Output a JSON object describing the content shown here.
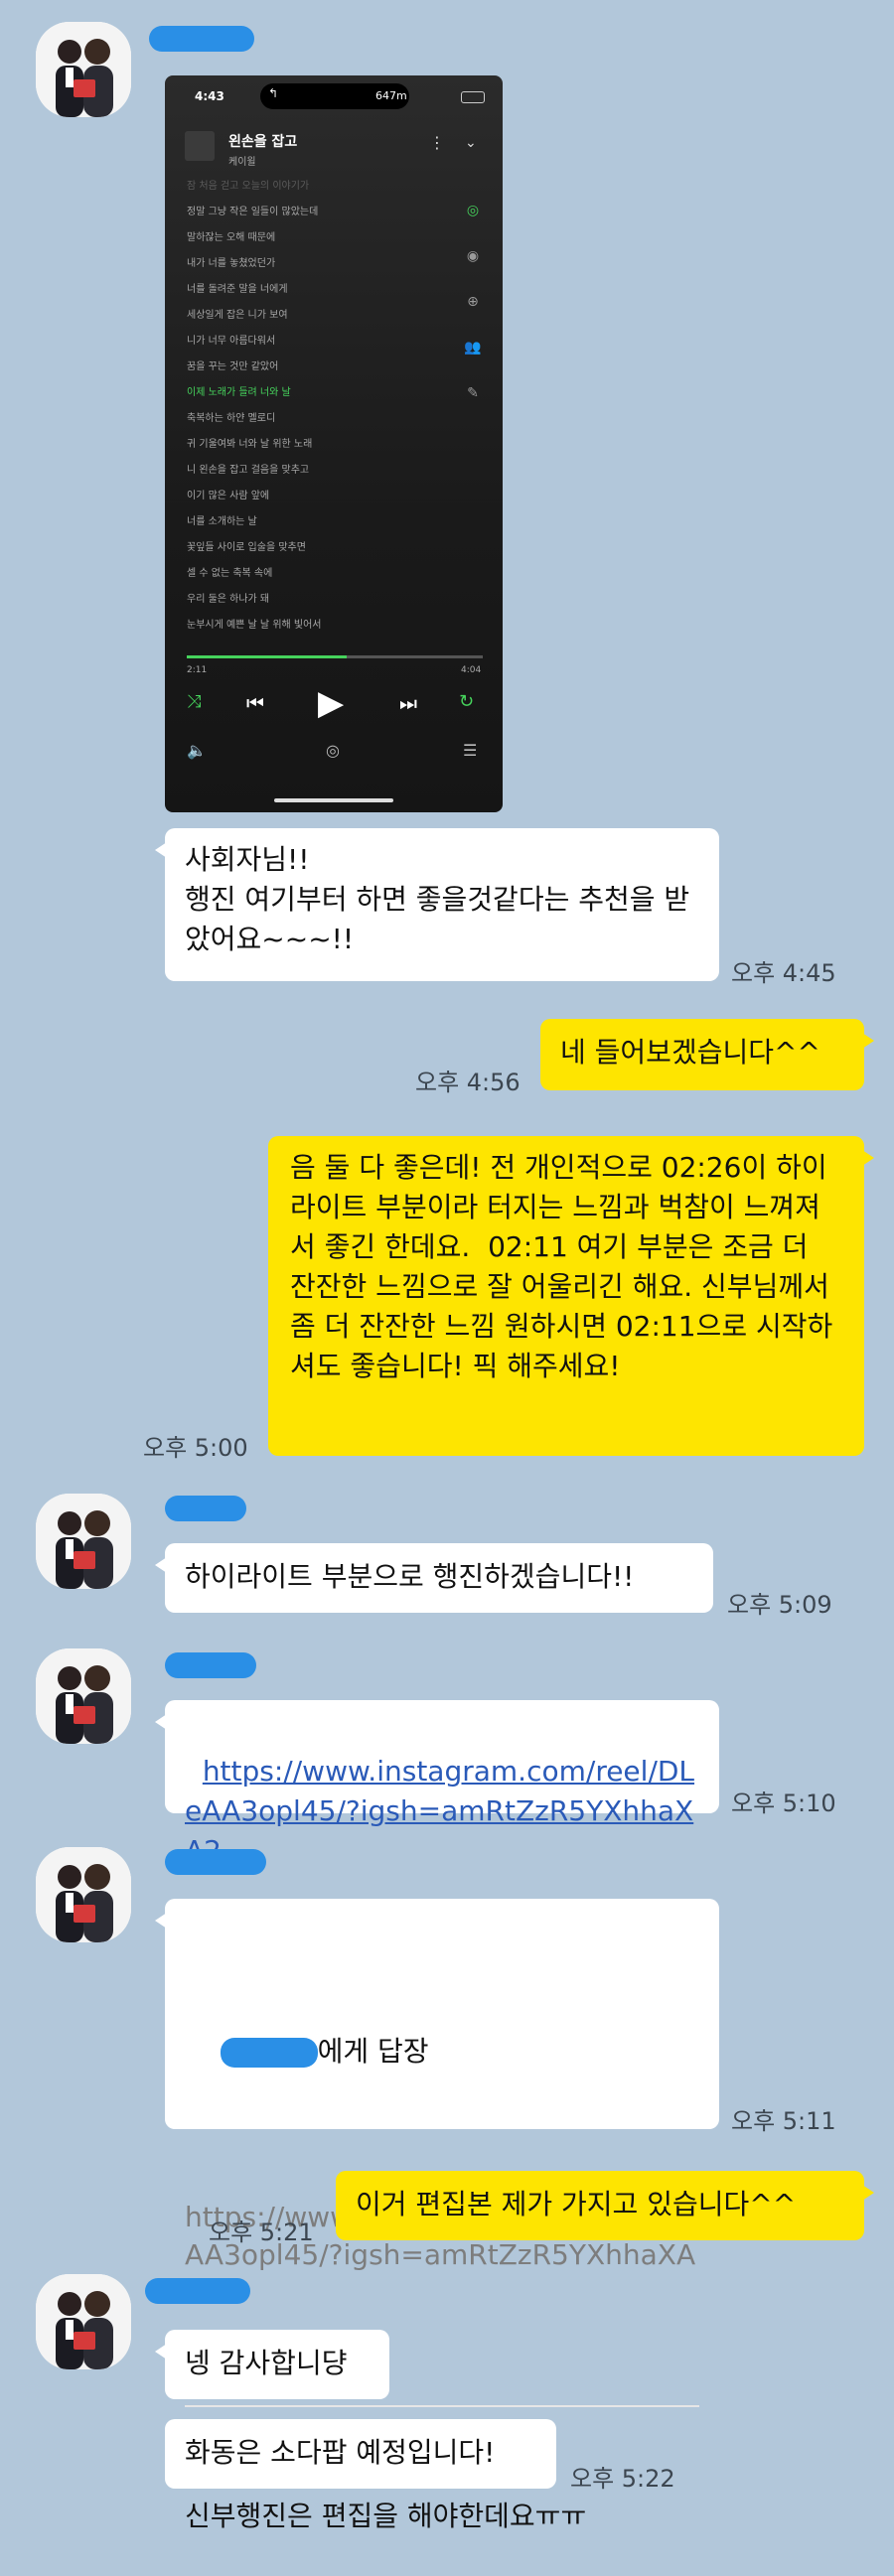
{
  "colors": {
    "background": "#b2c7da",
    "my_bubble": "#fee500",
    "their_bubble": "#ffffff",
    "accent_green": "#46d35c"
  },
  "screenshot": {
    "status_time": "4:43",
    "status_badge": "647m",
    "song_title": "왼손을 잡고",
    "artist": "케이윌",
    "lyrics": [
      "잠 처음 걷고 오늘의 이야기가",
      "정말 그냥 작은 일들이 많았는데",
      "말하잖는 오해 때문에",
      "내가 너를 놓쳤었던가",
      "너를 돌려준 말을 너에게",
      "세상일게 잡은 니가 보여",
      "니가 너무 아름다워서",
      "꿈을 꾸는 것만 같았어",
      "이제 노래가 들려 너와 날",
      "축복하는 하얀 멜로디",
      "귀 기울여봐 너와 날 위한 노래",
      "니 왼손을 잡고 걸음을 맞추고",
      "이기 많은 사람 앞에",
      "너를 소개하는 날",
      "꽃잎들 사이로 입술을 맞추면",
      "셀 수 없는 축복 속에",
      "우리 둘은 하나가 돼",
      "눈부시게 예쁜 날 날 위해 빛어서"
    ],
    "active_lyric_index": 8,
    "elapsed": "2:11",
    "duration": "4:04",
    "progress": 0.54
  },
  "messages": {
    "m1_text": "사회자님!!\n행진 여기부터 하면 좋을것같다는 추천을 받았어요~~~!!",
    "m1_time": "오후 4:45",
    "m2_text": "네 들어보겠습니다^^",
    "m2_time": "오후 4:56",
    "m3_text": "음 둘 다 좋은데! 전 개인적으로 02:26이 하이라이트 부분이라 터지는 느낌과 벅참이 느껴져서 좋긴 한데요.  02:11 여기 부분은 조금 더 잔잔한 느낌으로 잘 어울리긴 해요. 신부님께서 좀 더 잔잔한 느낌 원하시면 02:11으로 시작하셔도 좋습니다! 픽 해주세요!",
    "m3_time": "오후 5:00",
    "m4_text": "하이라이트 부분으로 행진하겠습니다!!",
    "m4_time": "오후 5:09",
    "m5_link": "https://www.instagram.com/reel/DLeAA3opl45/?igsh=amRtZzR5YXhhaXA2",
    "m5_time": "오후 5:10",
    "m6_reply_suffix": "에게 답장",
    "m6_quote": "https://www.instagram.com/reel/DLeAA3opl45/?igsh=amRtZzR5YXhhaXA2",
    "m6_text": "신부행진은 편집을 해야한데요ㅠㅠ",
    "m6_time": "오후 5:11",
    "m7_text": "이거 편집본 제가 가지고 있습니다^^",
    "m7_time": "오후 5:21",
    "m8_text": "넹 감사합니댱",
    "m9_text": "화동은 소다팝 예정입니다!",
    "m9_time": "오후 5:22"
  }
}
